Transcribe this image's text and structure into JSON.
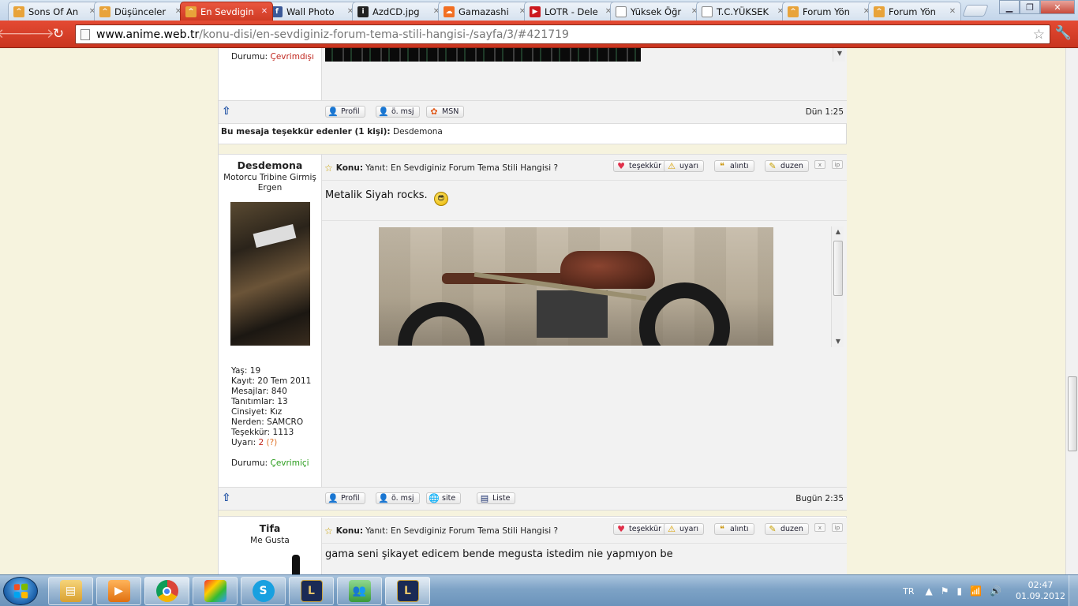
{
  "browser": {
    "tabs": [
      {
        "title": "Sons Of An",
        "icon": "anime-favicon",
        "color": "#e8a33a"
      },
      {
        "title": "Düşünceler",
        "icon": "anime-favicon",
        "color": "#e8a33a"
      },
      {
        "title": "En Sevdigin",
        "icon": "anime-favicon",
        "color": "#e8a33a",
        "active": true
      },
      {
        "title": "Wall Photo",
        "icon": "facebook-favicon",
        "color": "#3b5998"
      },
      {
        "title": "AzdCD.jpg",
        "icon": "image-host-favicon",
        "color": "#222222"
      },
      {
        "title": "Gamazashi",
        "icon": "soundcloud-favicon",
        "color": "#f26f23"
      },
      {
        "title": "LOTR - Dele",
        "icon": "youtube-favicon",
        "color": "#cc181e"
      },
      {
        "title": "Yüksek Öğr",
        "icon": "page-favicon",
        "color": "#ffffff"
      },
      {
        "title": "T.C.YÜKSEK",
        "icon": "page-favicon",
        "color": "#ffffff"
      },
      {
        "title": "Forum Yön",
        "icon": "anime-favicon",
        "color": "#e8a33a"
      },
      {
        "title": "Forum Yön",
        "icon": "anime-favicon",
        "color": "#e8a33a"
      }
    ],
    "url_host": "www.anime.web.tr",
    "url_path": "/konu-disi/en-sevdiginiz-forum-tema-stili-hangisi-/sayfa/3/#421719"
  },
  "prev_post": {
    "status_label": "Durumu:",
    "status_value": "Çevrimdışı",
    "date": "Dün 1:25",
    "buttons": {
      "profile": "Profil",
      "pm": "ö. msj",
      "msn": "MSN"
    },
    "thanks_label": "Bu mesaja teşekkür edenler (1 kişi):",
    "thanks_users": "Desdemona"
  },
  "post1": {
    "username": "Desdemona",
    "user_title": "Motorcu Tribine Girmiş",
    "user_rank": "Ergen",
    "stats": [
      {
        "label": "Yaş:",
        "value": "19"
      },
      {
        "label": "Kayıt:",
        "value": "20 Tem 2011"
      },
      {
        "label": "Mesajlar:",
        "value": "840"
      },
      {
        "label": "Tanıtımlar:",
        "value": "13"
      },
      {
        "label": "Cinsiyet:",
        "value": "Kız"
      },
      {
        "label": "Nerden:",
        "value": "SAMCRO"
      },
      {
        "label": "Teşekkür:",
        "value": "1113"
      }
    ],
    "warn_label": "Uyarı:",
    "warn_value": "2",
    "warn_q": "(?)",
    "status_label": "Durumu:",
    "status_value": "Çevrimiçi",
    "konu_label": "Konu:",
    "konu_title": "Yanıt: En Sevdiginiz Forum Tema Stili Hangisi ?",
    "message": "Metalik Siyah rocks.",
    "date": "Bugün 2:35",
    "buttons": {
      "profile": "Profil",
      "pm": "ö. msj",
      "site": "site",
      "list": "Liste"
    }
  },
  "post2": {
    "username": "Tifa",
    "user_title": "Me Gusta",
    "konu_label": "Konu:",
    "konu_title": "Yanıt: En Sevdiginiz Forum Tema Stili Hangisi ?",
    "message": "gama seni şikayet edicem bende megusta istedim nie yapmıyon be"
  },
  "post_actions": {
    "thanks": "teşekkür",
    "warn": "uyarı",
    "quote": "alıntı",
    "edit": "duzen",
    "delete": "x",
    "ip": "ip"
  },
  "taskbar": {
    "apps": [
      {
        "name": "explorer-icon",
        "color": "#e8b640"
      },
      {
        "name": "media-player-icon",
        "color": "#f08a24"
      },
      {
        "name": "chrome-icon",
        "color": "#d33b2c"
      },
      {
        "name": "movie-maker-icon",
        "color": "#49a632"
      },
      {
        "name": "skype-icon",
        "color": "#18a0e0"
      },
      {
        "name": "league-launcher-icon",
        "color": "#1a2a55"
      },
      {
        "name": "messenger-icon",
        "color": "#4aa84a"
      },
      {
        "name": "league-client-icon",
        "color": "#1a2a55"
      }
    ],
    "lang": "TR",
    "time": "02:47",
    "date": "01.09.2012"
  }
}
